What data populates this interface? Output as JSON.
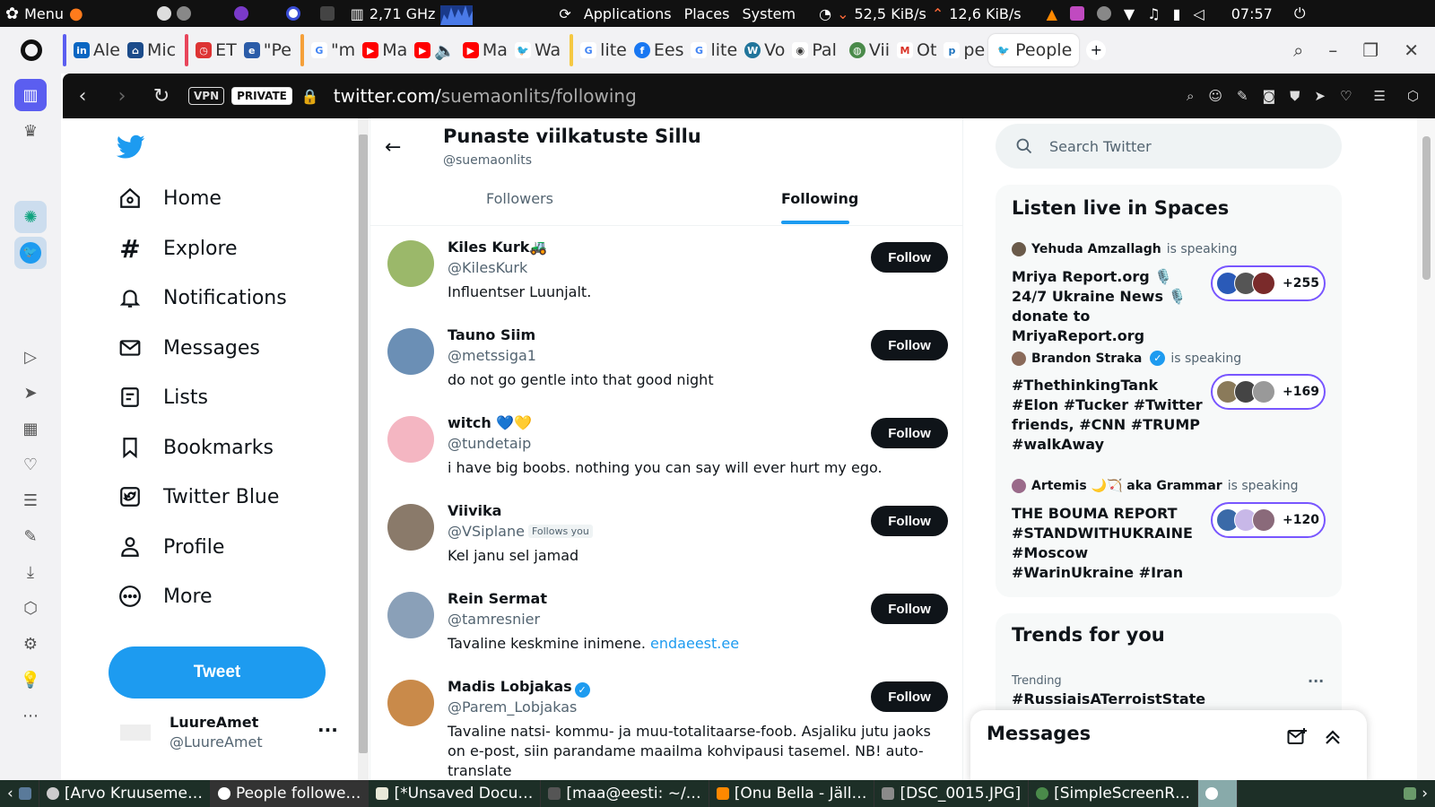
{
  "os_panel": {
    "menu_label": "Menu",
    "cpu_freq": "2,71 GHz",
    "places": [
      "Applications",
      "Places",
      "System"
    ],
    "net_down": "52,5 KiB/s",
    "net_up": "12,6 KiB/s",
    "clock": "07:57"
  },
  "browser": {
    "tabs": [
      {
        "label": "Ale",
        "icon": "linkedin-icon",
        "color": "#0a66c2"
      },
      {
        "label": "Mic",
        "icon": "bank-icon",
        "color": "#1b4b8a"
      },
      {
        "label": "ET",
        "icon": "stopwatch-icon",
        "color": "#d33"
      },
      {
        "label": "\"Pe",
        "icon": "err-icon",
        "color": "#2b5ca8"
      },
      {
        "label": "\"m",
        "icon": "google-icon",
        "color": "#4285f4"
      },
      {
        "label": "Ma",
        "icon": "youtube-icon",
        "color": "#ff0000"
      },
      {
        "label": "",
        "icon": "youtube-icon",
        "color": "#ff0000"
      },
      {
        "label": "Ma",
        "icon": "youtube-icon",
        "color": "#ff0000"
      },
      {
        "label": "Wa",
        "icon": "twitter-icon",
        "color": "#1d9bf0"
      },
      {
        "label": "lite",
        "icon": "google-icon",
        "color": "#4285f4"
      },
      {
        "label": "Ees",
        "icon": "facebook-icon",
        "color": "#1877f2"
      },
      {
        "label": "lite",
        "icon": "google-icon",
        "color": "#4285f4"
      },
      {
        "label": "Vo",
        "icon": "wordpress-icon",
        "color": "#21759b"
      },
      {
        "label": "Pal",
        "icon": "audio-icon",
        "color": "#555555"
      },
      {
        "label": "Vii",
        "icon": "globe-icon",
        "color": "#4a8a4a"
      },
      {
        "label": "Ot",
        "icon": "gmail-icon",
        "color": "#d93025"
      },
      {
        "label": "pe",
        "icon": "p-icon",
        "color": "#1e73be"
      },
      {
        "label": "People",
        "icon": "twitter-icon",
        "color": "#1d9bf0",
        "active": true
      }
    ],
    "vpn_label": "VPN",
    "private_label": "PRIVATE",
    "url_host": "twitter.com/",
    "url_path": "suemaonlits/following"
  },
  "twitter": {
    "nav": [
      {
        "label": "Home",
        "icon": "home-icon"
      },
      {
        "label": "Explore",
        "icon": "hashtag-icon"
      },
      {
        "label": "Notifications",
        "icon": "bell-icon"
      },
      {
        "label": "Messages",
        "icon": "envelope-icon"
      },
      {
        "label": "Lists",
        "icon": "list-icon"
      },
      {
        "label": "Bookmarks",
        "icon": "bookmark-icon"
      },
      {
        "label": "Twitter Blue",
        "icon": "twitter-blue-icon"
      },
      {
        "label": "Profile",
        "icon": "person-icon"
      },
      {
        "label": "More",
        "icon": "more-circle-icon"
      }
    ],
    "tweet_button": "Tweet",
    "account": {
      "name": "LuureAmet",
      "handle": "@LuureAmet"
    },
    "profile": {
      "name": "Punaste viilkatuste Sillu",
      "handle": "@suemaonlits"
    },
    "tabs": {
      "followers": "Followers",
      "following": "Following"
    },
    "follow_label": "Follow",
    "follows_you_label": "Follows you",
    "users": [
      {
        "name": "Kiles Kurk🚜",
        "handle": "@KilesKurk",
        "bio": "Influentser Luunjalt.",
        "avatar_color": "#9bb86a"
      },
      {
        "name": "Tauno Siim",
        "handle": "@metssiga1",
        "bio": "do not go gentle into that good night",
        "avatar_color": "#6b8fb5"
      },
      {
        "name": "witch 💙💛",
        "handle": "@tundetaip",
        "bio": "i have big boobs. nothing you can say will ever hurt my ego.",
        "avatar_color": "#f4b6c2"
      },
      {
        "name": "Viivika",
        "handle": "@VSiplane",
        "bio": "Kel janu sel jamad",
        "avatar_color": "#8a7a6a",
        "follows_you": true
      },
      {
        "name": "Rein Sermat",
        "handle": "@tamresnier",
        "bio": "Tavaline keskmine inimene.",
        "link": "endaeest.ee",
        "avatar_color": "#8aa0b8"
      },
      {
        "name": "Madis Lobjakas",
        "handle": "@Parem_Lobjakas",
        "bio": "Tavaline natsi- kommu- ja muu-totalitaarse-foob. Asjaliku jutu jaoks on e-post, siin parandame maailma kohvipausi tasemel. NB! auto-translate",
        "avatar_color": "#c98a4a",
        "verified": true
      }
    ],
    "search_placeholder": "Search Twitter",
    "spaces": {
      "title": "Listen live in Spaces",
      "is_speaking": "is speaking",
      "items": [
        {
          "speaker": "Yehuda Amzallagh",
          "title": "Mriya Report.org 🎙️24/7 Ukraine News 🎙️donate to MriyaReport.org",
          "count": "+255",
          "verified": false
        },
        {
          "speaker": "Brandon Straka",
          "title": "#ThethinkingTank #Elon #Tucker #Twitter friends, #CNN #TRUMP #walkAway",
          "count": "+169",
          "verified": true
        },
        {
          "speaker": "Artemis 🌙🏹 aka Grammar",
          "title": "THE BOUMA REPORT #STANDWITHUKRAINE #Moscow #WarinUkraine #Iran",
          "count": "+120",
          "verified": false
        }
      ]
    },
    "trends": {
      "title": "Trends for you",
      "meta": "Trending",
      "name": "#RussiaisATerroistState"
    },
    "messages_drawer": "Messages"
  },
  "taskbar": [
    {
      "label": "[Arvo Kruuseme…"
    },
    {
      "label": "People followe…",
      "active": true
    },
    {
      "label": "[*Unsaved Docu…"
    },
    {
      "label": "[maa@eesti: ~/…"
    },
    {
      "label": "[Onu Bella - Jäll…"
    },
    {
      "label": "[DSC_0015.JPG]"
    },
    {
      "label": "[SimpleScreenR…"
    }
  ]
}
